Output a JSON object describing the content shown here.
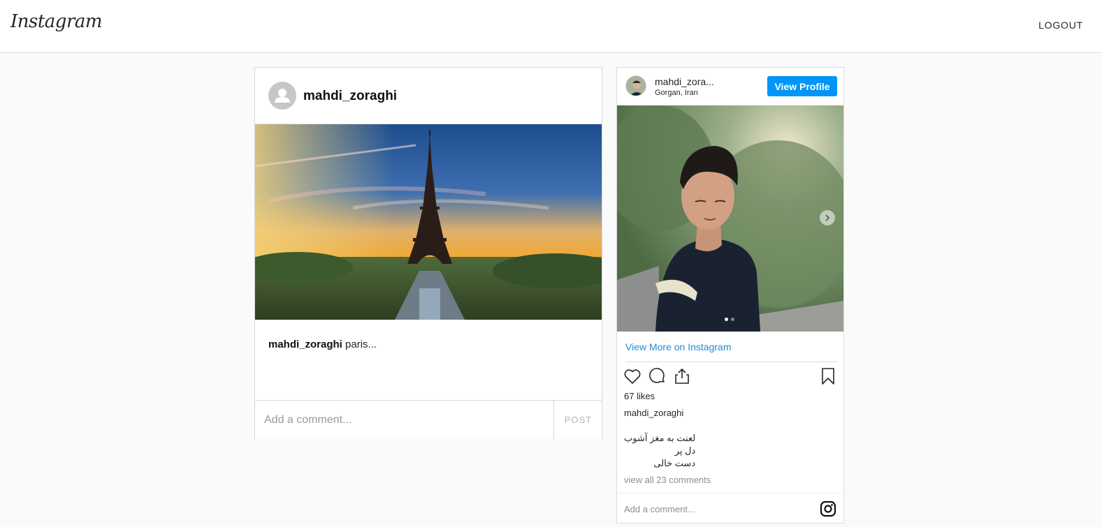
{
  "header": {
    "logo": "Instagram",
    "logout": "LOGOUT"
  },
  "post": {
    "username": "mahdi_zoraghi",
    "caption_user": "mahdi_zoraghi",
    "caption_text": " paris...",
    "comment_placeholder": "Add a comment...",
    "post_button": "POST"
  },
  "embed": {
    "username": "mahdi_zora...",
    "location": "Gorgan, Iran",
    "view_profile": "View Profile",
    "view_more": "View More on Instagram",
    "likes": "67 likes",
    "caption_user": "mahdi_zoraghi",
    "caption_lines": [
      "لعنت به مغز آشوب",
      "دل پر",
      "دست خالی"
    ],
    "view_all": "view all 23 comments",
    "comment_placeholder": "Add a comment...",
    "carousel": {
      "current": 1,
      "total": 2
    }
  },
  "colors": {
    "accent": "#0095f6",
    "link": "#1f8ad6",
    "border": "#dbdbdb"
  }
}
